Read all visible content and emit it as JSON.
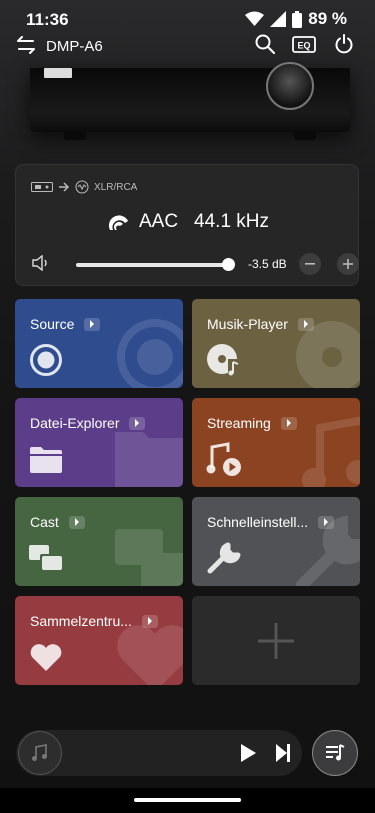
{
  "status_bar": {
    "time": "11:36",
    "battery": "89 %"
  },
  "header": {
    "device_name": "DMP-A6",
    "icons": [
      "swap-icon",
      "search-icon",
      "eq-icon",
      "power-icon"
    ],
    "eq_label": "EQ"
  },
  "now_playing_info": {
    "output_route": "XLR/RCA",
    "format": "AAC",
    "sample_rate": "44.1 kHz",
    "volume": {
      "value_text": "-3.5 dB",
      "level_fraction": 0.96
    }
  },
  "tiles": [
    {
      "label": "Source",
      "color": "#2f4c8f",
      "icon": "source-icon"
    },
    {
      "label": "Musik-Player",
      "color": "#6c6242",
      "icon": "music-disc-icon"
    },
    {
      "label": "Datei-Explorer",
      "color": "#5c3d89",
      "icon": "folder-icon"
    },
    {
      "label": "Streaming",
      "color": "#8b4321",
      "icon": "music-note-play-icon"
    },
    {
      "label": "Cast",
      "color": "#466642",
      "icon": "cast-icon"
    },
    {
      "label": "Schnelleinstell...",
      "color": "#505256",
      "icon": "wrench-icon"
    },
    {
      "label": "Sammelzentru...",
      "color": "#963b40",
      "icon": "heart-icon"
    },
    {
      "label": "",
      "color": "#2b2b2c",
      "icon": "add-icon"
    }
  ],
  "player": {
    "icons": [
      "music-note-icon",
      "play-icon",
      "skip-next-icon",
      "queue-icon"
    ]
  }
}
